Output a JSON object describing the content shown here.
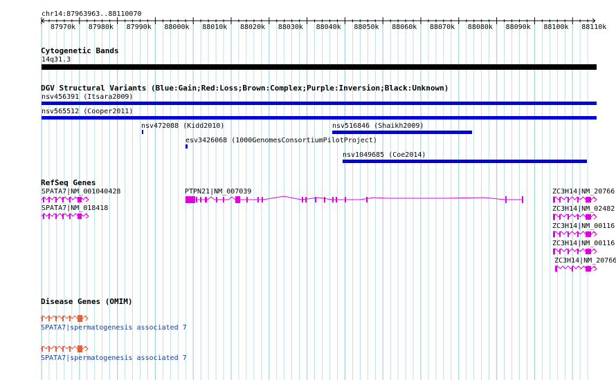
{
  "browser": {
    "location": "chr14:87963963..88110070",
    "ruler_ticks": [
      "87970k",
      "87980k",
      "87990k",
      "88000k",
      "88010k",
      "88020k",
      "88030k",
      "88040k",
      "88050k",
      "88060k",
      "88070k",
      "88080k",
      "88090k",
      "88100k",
      "88110k"
    ]
  },
  "tracks": {
    "cytoband": {
      "title": "Cytogenetic Bands",
      "band": "14q31.3"
    },
    "dgv": {
      "title": "DGV Structural Variants (Blue:Gain;Red:Loss;Brown:Complex;Purple:Inversion;Black:Unknown)",
      "items": [
        {
          "label": "nsv456391 (Itsara2009)"
        },
        {
          "label": "nsv565512 (Cooper2011)"
        },
        {
          "label": "nsv472088 (Kidd2010)"
        },
        {
          "label": "nsv516846 (Shaikh2009)"
        },
        {
          "label": "esv3426068 (1000GenomesConsortiumPilotProject)"
        },
        {
          "label": "nsv1049685 (Coe2014)"
        }
      ]
    },
    "refseq": {
      "title": "RefSeq Genes",
      "items": [
        {
          "label": "SPATA7|NM_001040428"
        },
        {
          "label": "SPATA7|NM_018418"
        },
        {
          "label": "PTPN21|NM_007039"
        },
        {
          "label": "ZC3H14|NM_20766"
        },
        {
          "label": "ZC3H14|NM_02482"
        },
        {
          "label": "ZC3H14|NM_00116"
        },
        {
          "label": "ZC3H14|NM_00116"
        },
        {
          "label": "ZC3H14|NM_20766"
        }
      ]
    },
    "omim": {
      "title": "Disease Genes (OMIM)",
      "items": [
        {
          "label": "SPATA7|spermatogenesis associated 7"
        },
        {
          "label": "SPATA7|spermatogenesis associated 7"
        }
      ]
    }
  },
  "colors": {
    "grid": "#9fd3e0",
    "gain": "#0000e0",
    "gene": "#e000e0",
    "omim": "#e06040",
    "band": "#000000"
  }
}
